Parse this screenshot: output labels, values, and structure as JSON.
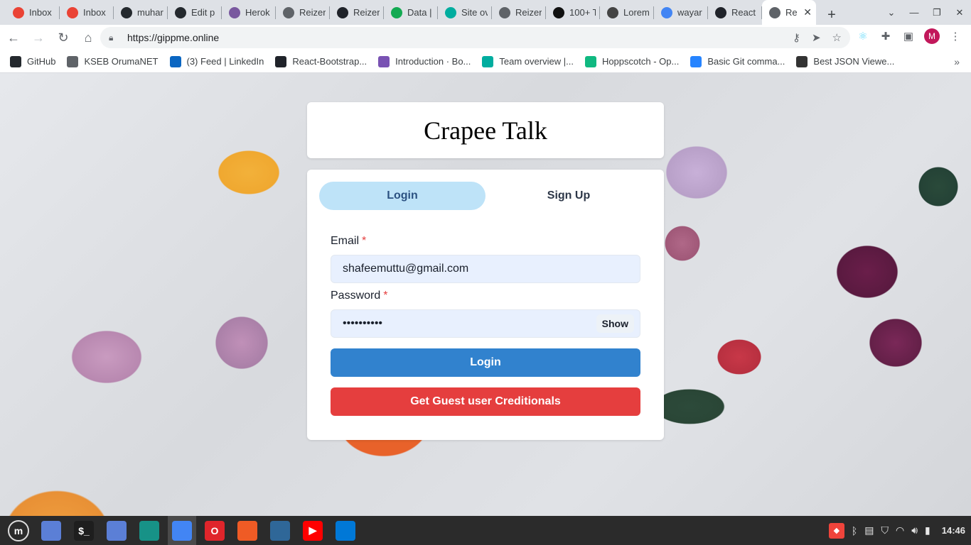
{
  "browser": {
    "tabs": [
      {
        "title": "Inbox",
        "icon": "gmail-icon",
        "color": "#ea4335"
      },
      {
        "title": "Inbox",
        "icon": "gmail-icon",
        "color": "#ea4335"
      },
      {
        "title": "muhar",
        "icon": "github-icon",
        "color": "#24292e"
      },
      {
        "title": "Edit p",
        "icon": "github-icon",
        "color": "#24292e"
      },
      {
        "title": "Herok",
        "icon": "heroku-icon",
        "color": "#79589f"
      },
      {
        "title": "Reizer",
        "icon": "globe-icon",
        "color": "#5f6368"
      },
      {
        "title": "Reizer",
        "icon": "react-icon",
        "color": "#20232a"
      },
      {
        "title": "Data |",
        "icon": "mongodb-icon",
        "color": "#13aa52"
      },
      {
        "title": "Site ov",
        "icon": "netlify-icon",
        "color": "#00ad9f"
      },
      {
        "title": "Reizer",
        "icon": "globe-icon",
        "color": "#5f6368"
      },
      {
        "title": "100+ T",
        "icon": "unsplash-icon",
        "color": "#111111"
      },
      {
        "title": "Lorem",
        "icon": "lorem-icon",
        "color": "#444444"
      },
      {
        "title": "wayar",
        "icon": "google-icon",
        "color": "#4285f4"
      },
      {
        "title": "React",
        "icon": "react-icon",
        "color": "#20232a"
      },
      {
        "title": "Re",
        "icon": "globe-icon",
        "color": "#5f6368",
        "active": true
      }
    ],
    "url": "https://gippme.online",
    "avatar_letter": "M",
    "bookmarks": [
      {
        "label": "GitHub",
        "icon": "github-icon",
        "color": "#24292e"
      },
      {
        "label": "KSEB OrumaNET",
        "icon": "globe-icon",
        "color": "#5f6368"
      },
      {
        "label": "(3) Feed | LinkedIn",
        "icon": "linkedin-icon",
        "color": "#0a66c2"
      },
      {
        "label": "React-Bootstrap...",
        "icon": "react-icon",
        "color": "#20232a"
      },
      {
        "label": "Introduction · Bo...",
        "icon": "bootstrap-icon",
        "color": "#7952b3"
      },
      {
        "label": "Team overview |...",
        "icon": "netlify-icon",
        "color": "#00ad9f"
      },
      {
        "label": "Hoppscotch - Op...",
        "icon": "hoppscotch-icon",
        "color": "#10b981"
      },
      {
        "label": "Basic Git comma...",
        "icon": "atlassian-icon",
        "color": "#2684ff"
      },
      {
        "label": "Best JSON Viewe...",
        "icon": "codebeautify-icon",
        "color": "#333333"
      }
    ]
  },
  "page": {
    "title": "Crapee Talk",
    "tabs": {
      "login": "Login",
      "signup": "Sign Up"
    },
    "email_label": "Email",
    "email_value": "shafeemuttu@gmail.com",
    "password_label": "Password",
    "password_value": "••••••••••",
    "required_mark": "*",
    "show_label": "Show",
    "login_button": "Login",
    "guest_button": "Get Guest user Creditionals"
  },
  "taskbar": {
    "apps": [
      {
        "name": "files",
        "color": "#5b7fd6",
        "glyph": ""
      },
      {
        "name": "terminal",
        "color": "#1e1e1e",
        "glyph": "$_"
      },
      {
        "name": "files-2",
        "color": "#5b7fd6",
        "glyph": ""
      },
      {
        "name": "gitkraken",
        "color": "#179287",
        "glyph": ""
      },
      {
        "name": "chrome",
        "color": "#4285f4",
        "glyph": "",
        "active": true
      },
      {
        "name": "opera",
        "color": "#e0252b",
        "glyph": "O"
      },
      {
        "name": "postman",
        "color": "#ef5b25",
        "glyph": ""
      },
      {
        "name": "mysql-workbench",
        "color": "#2f6798",
        "glyph": ""
      },
      {
        "name": "youtube",
        "color": "#ff0000",
        "glyph": "▶"
      },
      {
        "name": "vscode",
        "color": "#0078d7",
        "glyph": ""
      }
    ],
    "clock": "14:46"
  },
  "colors": {
    "accent_primary": "#3182ce",
    "accent_danger": "#e53e3e",
    "tab_active_bg": "#bee3f8"
  }
}
